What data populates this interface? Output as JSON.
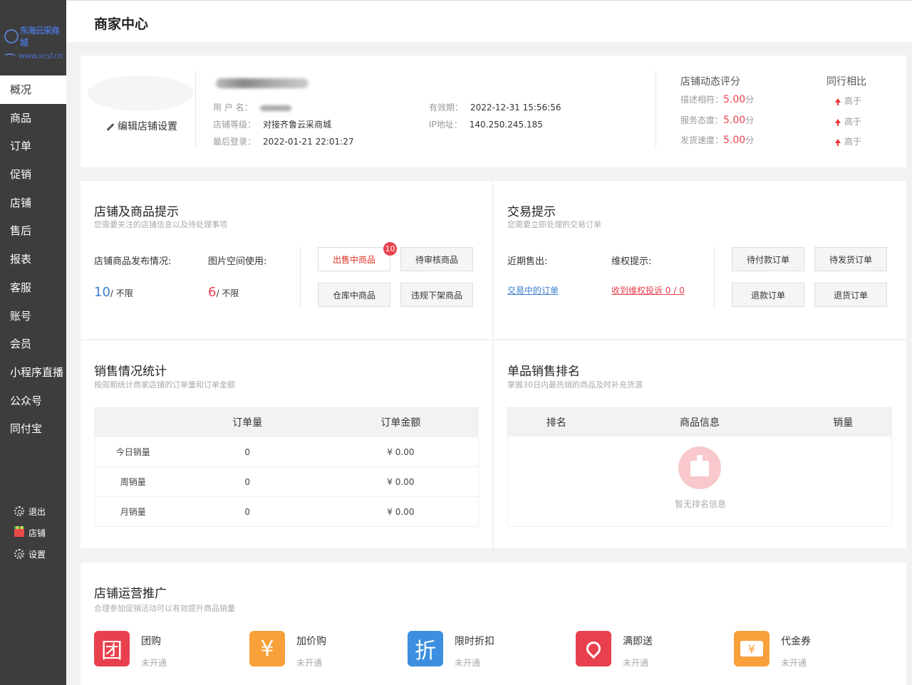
{
  "sidebar": {
    "logo_line1": "东海云采商城",
    "logo_line2": "www.xcsf.cn",
    "items": [
      {
        "label": "概况"
      },
      {
        "label": "商品"
      },
      {
        "label": "订单"
      },
      {
        "label": "促销"
      },
      {
        "label": "店铺"
      },
      {
        "label": "售后"
      },
      {
        "label": "报表"
      },
      {
        "label": "客服"
      },
      {
        "label": "账号"
      },
      {
        "label": "会员"
      },
      {
        "label": "小程序直播"
      },
      {
        "label": "公众号"
      },
      {
        "label": "同付宝"
      }
    ],
    "bottom": {
      "logout": "退出",
      "store": "店铺",
      "settings": "设置"
    }
  },
  "header": {
    "title": "商家中心"
  },
  "store_info": {
    "edit_label": "编辑店铺设置",
    "username_label": "用 户 名：",
    "level_label": "店铺等级：",
    "level_value": "对接齐鲁云采商城",
    "last_login_label": "最后登录：",
    "last_login_value": "2022-01-21 22:01:27",
    "expiry_label": "有效期：",
    "expiry_value": "2022-12-31 15:56:56",
    "ip_label": "IP地址：",
    "ip_value": "140.250.245.185",
    "rating_title": "店铺动态评分",
    "compare_title": "同行相比",
    "ratings": [
      {
        "label": "描述相符：",
        "value": "5.00",
        "unit": "分",
        "compare": "高于"
      },
      {
        "label": "服务态度：",
        "value": "5.00",
        "unit": "分",
        "compare": "高于"
      },
      {
        "label": "发货速度：",
        "value": "5.00",
        "unit": "分",
        "compare": "高于"
      }
    ]
  },
  "store_tips": {
    "title": "店铺及商品提示",
    "subtitle": "您需要关注的店铺信息以及待处理事项",
    "publish_label": "店铺商品发布情况:",
    "publish_value": "10",
    "publish_limit": "/ 不限",
    "image_label": "图片空间使用:",
    "image_value": "6",
    "image_limit": "/ 不限",
    "buttons": {
      "on_sale": "出售中商品",
      "on_sale_badge": "10",
      "pending": "待审核商品",
      "warehouse": "仓库中商品",
      "violation": "违规下架商品"
    }
  },
  "trade_tips": {
    "title": "交易提示",
    "subtitle": "您需要立即处理的交易订单",
    "recent_label": "近期售出:",
    "rights_label": "维权提示:",
    "recent_link": "交易中的订单",
    "rights_link": "收到维权投诉 0 / 0",
    "buttons": {
      "unpaid": "待付款订单",
      "unshipped": "待发货订单",
      "refund": "退款订单",
      "return": "退货订单"
    }
  },
  "sales_stats": {
    "title": "销售情况统计",
    "subtitle": "按周期统计商家店铺的订单量和订单金额",
    "columns": [
      "",
      "订单量",
      "订单金额"
    ],
    "rows": [
      {
        "label": "今日销量",
        "orders": "0",
        "amount": "¥ 0.00"
      },
      {
        "label": "周销量",
        "orders": "0",
        "amount": "¥ 0.00"
      },
      {
        "label": "月销量",
        "orders": "0",
        "amount": "¥ 0.00"
      }
    ]
  },
  "ranking": {
    "title": "单品销售排名",
    "subtitle": "掌握30日内最热销的商品及时补充货源",
    "columns": [
      "排名",
      "商品信息",
      "销量"
    ],
    "empty_text": "暂无排名信息"
  },
  "promotion": {
    "title": "店铺运营推广",
    "subtitle": "合理参加促销活动可以有效提升商品销量",
    "items": [
      {
        "glyph": "团",
        "name": "团购",
        "status": "未开通",
        "color": "#e8414d"
      },
      {
        "glyph": "¥",
        "name": "加价购",
        "status": "未开通",
        "color": "#f8a03a"
      },
      {
        "glyph": "折",
        "name": "限时折扣",
        "status": "未开通",
        "color": "#3c8fe0"
      },
      {
        "glyph": "🎀",
        "name": "满即送",
        "status": "未开通",
        "color": "#e8414d"
      },
      {
        "glyph": "¥",
        "name": "代金券",
        "status": "未开通",
        "color": "#f8a03a"
      }
    ]
  }
}
